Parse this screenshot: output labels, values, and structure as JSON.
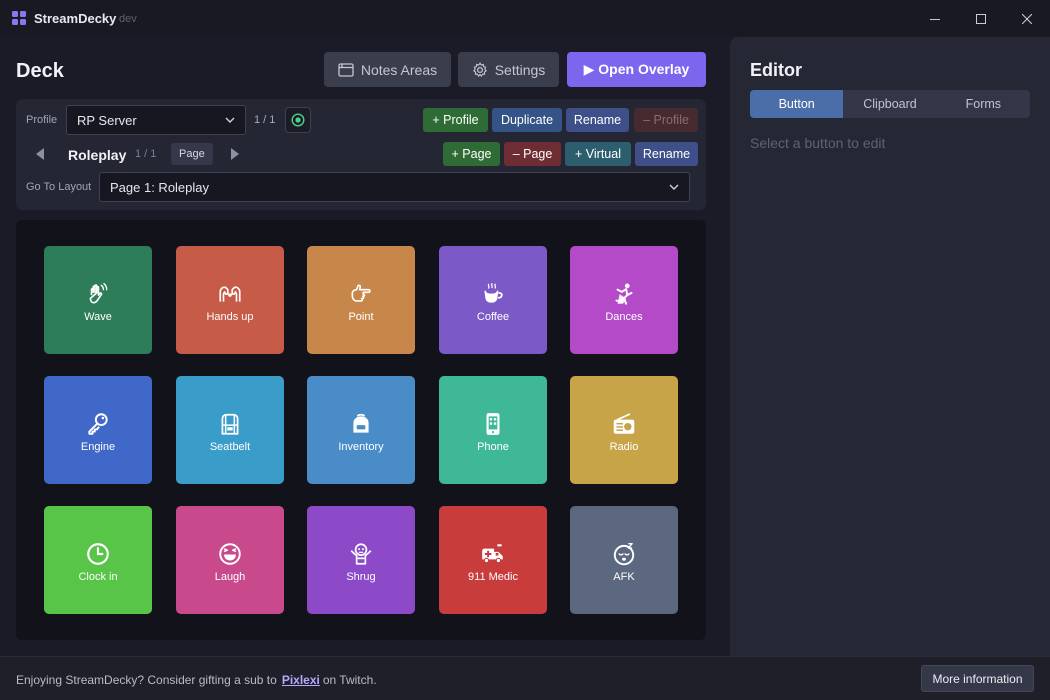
{
  "app": {
    "name": "StreamDecky",
    "env": "dev"
  },
  "window": {
    "minimize": "minimize",
    "maximize": "maximize",
    "close": "close"
  },
  "deck": {
    "title": "Deck",
    "notes_label": "Notes Areas",
    "settings_label": "Settings",
    "overlay_label": "▶ Open Overlay"
  },
  "profile": {
    "label": "Profile",
    "selected": "RP Server",
    "count": "1 / 1",
    "add_label": "+ Profile",
    "duplicate_label": "Duplicate",
    "rename_label": "Rename",
    "remove_label": "– Profile"
  },
  "page": {
    "name": "Roleplay",
    "count": "1 / 1",
    "badge": "Page",
    "add_label": "+ Page",
    "remove_label": "– Page",
    "virtual_label": "+ Virtual",
    "rename_label": "Rename"
  },
  "layout": {
    "label": "Go To Layout",
    "selected": "Page 1: Roleplay"
  },
  "buttons": [
    {
      "label": "Wave",
      "icon": "wave-icon",
      "color": "#2e7d5a"
    },
    {
      "label": "Hands up",
      "icon": "hands-up-icon",
      "color": "#c65c48"
    },
    {
      "label": "Point",
      "icon": "point-icon",
      "color": "#c8874a"
    },
    {
      "label": "Coffee",
      "icon": "coffee-icon",
      "color": "#7b5ac8"
    },
    {
      "label": "Dances",
      "icon": "dances-icon",
      "color": "#b44ac8"
    },
    {
      "label": "Engine",
      "icon": "key-icon",
      "color": "#3f68c8"
    },
    {
      "label": "Seatbelt",
      "icon": "seatbelt-icon",
      "color": "#3a9cc8"
    },
    {
      "label": "Inventory",
      "icon": "backpack-icon",
      "color": "#4a8cc8"
    },
    {
      "label": "Phone",
      "icon": "phone-icon",
      "color": "#3fb898"
    },
    {
      "label": "Radio",
      "icon": "radio-icon",
      "color": "#c8a448"
    },
    {
      "label": "Clock in",
      "icon": "clock-icon",
      "color": "#58c448"
    },
    {
      "label": "Laugh",
      "icon": "laugh-icon",
      "color": "#c84a8c"
    },
    {
      "label": "Shrug",
      "icon": "shrug-icon",
      "color": "#8c4ac8"
    },
    {
      "label": "911 Medic",
      "icon": "ambulance-icon",
      "color": "#c83c3c"
    },
    {
      "label": "AFK",
      "icon": "sleep-icon",
      "color": "#5c6880"
    }
  ],
  "editor": {
    "title": "Editor",
    "tabs": [
      "Button",
      "Clipboard",
      "Forms"
    ],
    "hint": "Select a button to edit"
  },
  "footer": {
    "text_before": "Enjoying StreamDecky? Consider gifting a sub to",
    "link": "Pixlexi",
    "text_after": "on Twitch.",
    "more_label": "More information"
  }
}
